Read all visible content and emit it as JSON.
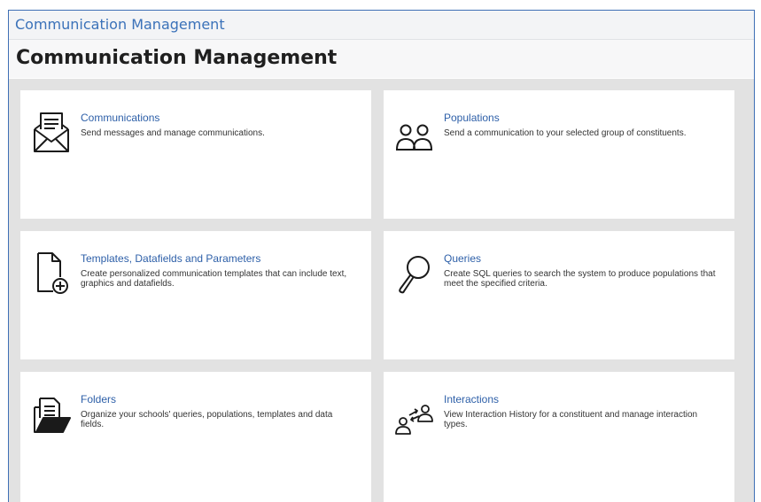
{
  "breadcrumb": "Communication Management",
  "page_title": "Communication Management",
  "colors": {
    "link": "#3b72b9",
    "border": "#3f6fb5",
    "grid_bg": "#e2e2e2"
  },
  "cards": [
    {
      "title": "Communications",
      "description": "Send messages and manage communications.",
      "icon": "envelope-open-icon"
    },
    {
      "title": "Populations",
      "description": "Send a communication to your selected group of constituents.",
      "icon": "people-icon"
    },
    {
      "title": "Templates, Datafields and Parameters",
      "description": "Create personalized communication templates that can include text, graphics and datafields.",
      "icon": "document-add-icon"
    },
    {
      "title": "Queries",
      "description": "Create SQL queries to search the system to produce populations that meet the specified criteria.",
      "icon": "magnifier-icon"
    },
    {
      "title": "Folders",
      "description": "Organize your schools' queries, populations, templates and data fields.",
      "icon": "folder-documents-icon"
    },
    {
      "title": "Interactions",
      "description": "View Interaction History for a constituent and manage interaction types.",
      "icon": "interaction-icon"
    }
  ]
}
